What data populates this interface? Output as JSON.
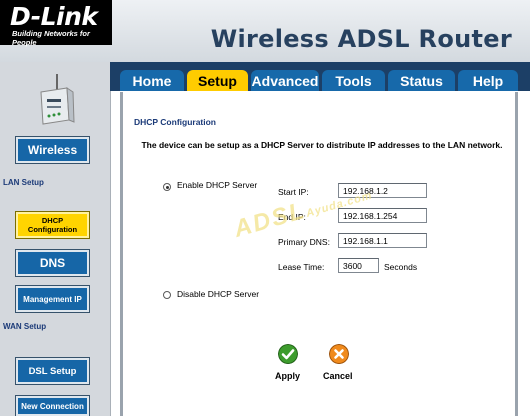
{
  "header": {
    "brand": "D-Link",
    "tagline": "Building Networks for People",
    "product_title": "Wireless ADSL Router"
  },
  "tabs": [
    {
      "label": "Home",
      "active": false
    },
    {
      "label": "Setup",
      "active": true
    },
    {
      "label": "Advanced",
      "active": false
    },
    {
      "label": "Tools",
      "active": false
    },
    {
      "label": "Status",
      "active": false
    },
    {
      "label": "Help",
      "active": false
    }
  ],
  "sidebar": {
    "wireless": "Wireless",
    "lan_setup": "LAN Setup",
    "dhcp_configuration": "DHCP Configuration",
    "dns": "DNS",
    "management_ip": "Management IP",
    "wan_setup": "WAN Setup",
    "dsl_setup": "DSL Setup",
    "new_connection": "New Connection"
  },
  "main": {
    "section_title": "DHCP Configuration",
    "intro": "The device can be setup as a DHCP Server to distribute IP addresses to the LAN network.",
    "enable_label": "Enable DHCP Server",
    "disable_label": "Disable DHCP Server",
    "dhcp_enabled": true,
    "fields": {
      "start_ip_label": "Start IP:",
      "start_ip": "192.168.1.2",
      "end_ip_label": "End IP:",
      "end_ip": "192.168.1.254",
      "primary_dns_label": "Primary DNS:",
      "primary_dns": "192.168.1.1",
      "lease_time_label": "Lease Time:",
      "lease_time": "3600",
      "lease_unit": "Seconds"
    },
    "apply_label": "Apply",
    "cancel_label": "Cancel"
  },
  "watermark": {
    "main": "ADSL",
    "sub": "Ayuda.com"
  },
  "colors": {
    "brand_black": "#000000",
    "title_blue": "#27415f",
    "tab_blue": "#1769aa",
    "tab_active": "#ffcc00",
    "sidebar_button": "#1666a7",
    "sidebar_active": "#ffd400",
    "label_blue": "#1b3a78"
  }
}
